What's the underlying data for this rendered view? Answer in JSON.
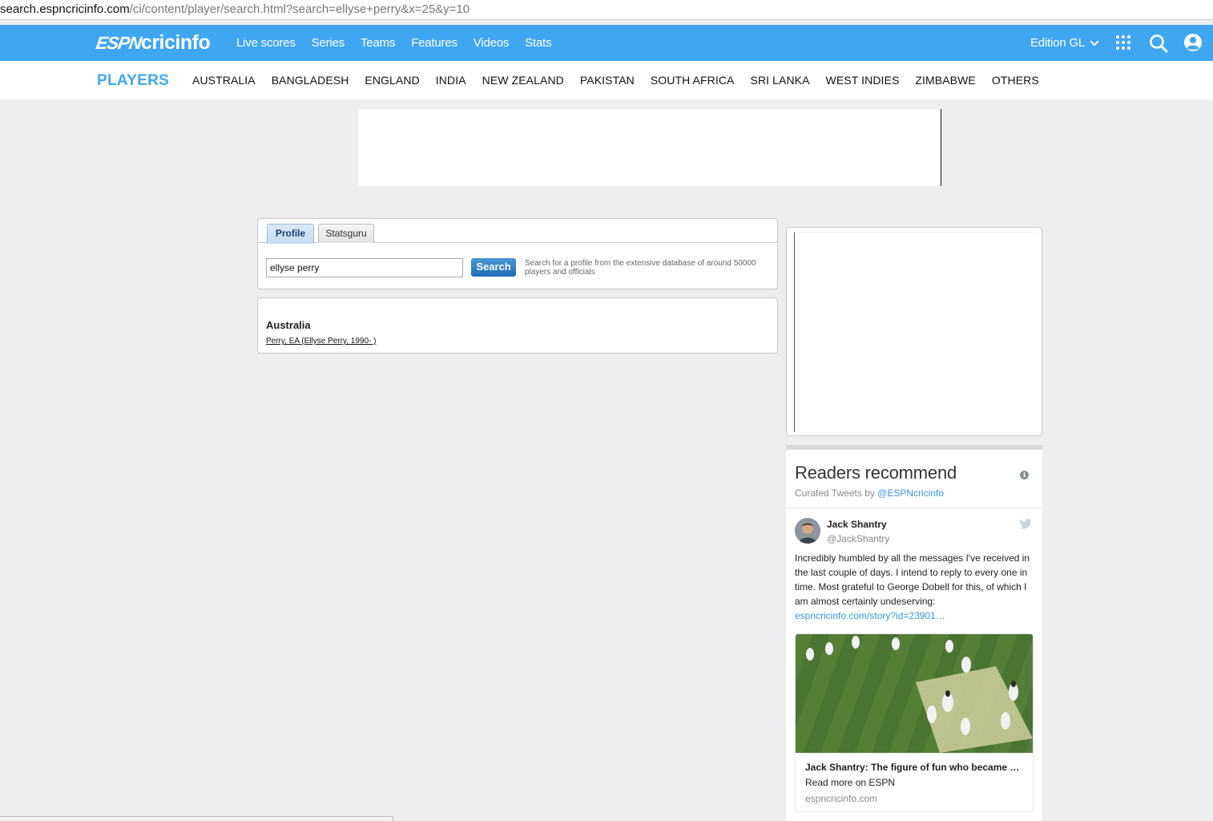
{
  "browser": {
    "url_host": "search.espncricinfo.com",
    "url_path": "/ci/content/player/search.html?search=ellyse+perry&x=25&y=10"
  },
  "topnav": {
    "logo_espn": "ESPN",
    "logo_cricinfo": "cricinfo",
    "links": [
      "Live scores",
      "Series",
      "Teams",
      "Features",
      "Videos",
      "Stats"
    ],
    "edition": "Edition GL",
    "brand_color": "#3fa6f1"
  },
  "subnav": {
    "title": "PLAYERS",
    "countries": [
      "AUSTRALIA",
      "BANGLADESH",
      "ENGLAND",
      "INDIA",
      "NEW ZEALAND",
      "PAKISTAN",
      "SOUTH AFRICA",
      "SRI LANKA",
      "WEST INDIES",
      "ZIMBABWE",
      "OTHERS"
    ]
  },
  "search": {
    "tabs": [
      "Profile",
      "Statsguru"
    ],
    "active_tab": "Profile",
    "input_value": "ellyse perry",
    "button_label": "Search",
    "hint": "Search for a profile from the extensive database of around 50000 players and officials"
  },
  "results": {
    "country": "Australia",
    "items": [
      "Perry, EA (Ellyse Perry, 1990- )"
    ]
  },
  "readers": {
    "title": "Readers recommend",
    "curated_prefix": "Curated Tweets by ",
    "curated_handle": "@ESPNcricinfo",
    "tweet": {
      "name": "Jack Shantry",
      "handle": "@JackShantry",
      "text": "Incredibly humbled by all the messages I've received in the last couple of days. I intend to reply to every one in time. Most grateful to George Dobell for this, of which I am almost certainly undeserving: ",
      "link": "espncricinfo.com/story?id=23901…",
      "card_title": "Jack Shantry: The figure of fun who became …",
      "card_desc": "Read more on ESPN",
      "card_domain": "espncricinfo.com"
    }
  }
}
